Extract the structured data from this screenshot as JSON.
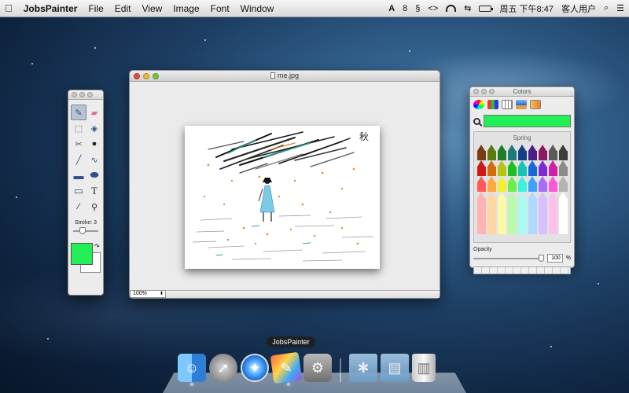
{
  "menubar": {
    "app_name": "JobsPainter",
    "menus": [
      "File",
      "Edit",
      "View",
      "Image",
      "Font",
      "Window"
    ],
    "status": {
      "adobe": "A",
      "notifications": "8",
      "clock": "周五 下午8:47",
      "user": "客人用户"
    }
  },
  "tools": {
    "stroke_label": "Stroke: 3",
    "foreground_color": "#22ee55",
    "background_color": "#ffffff"
  },
  "document": {
    "title": "me.jpg",
    "zoom": "100%",
    "signature": "秋"
  },
  "colors_panel": {
    "title": "Colors",
    "current_color": "#22ee55",
    "box_name": "Spring",
    "opacity_label": "Opacity",
    "opacity_value": "100",
    "opacity_unit": "%",
    "opacity_fraction": 1.0,
    "crayon_rows": [
      [
        "#7b3b12",
        "#5a7a10",
        "#1f7c2b",
        "#1c7a78",
        "#133e8a",
        "#4b1f86",
        "#8a1a5e",
        "#5a5a5a",
        "#3c3c3c"
      ],
      [
        "#d11818",
        "#d46c0f",
        "#b6c414",
        "#1fbf24",
        "#14c4b4",
        "#1769d9",
        "#7d2ad6",
        "#d31ea8",
        "#8a8a8a"
      ],
      [
        "#ff5a5a",
        "#ffa83d",
        "#f3f032",
        "#6bf04a",
        "#3ef0de",
        "#3fa3ff",
        "#a96bff",
        "#ff5ad6",
        "#b3b3b3"
      ],
      [
        "#ffb3b3",
        "#ffd6a1",
        "#fbf9a8",
        "#b8fbaa",
        "#a7fbf3",
        "#b0d7ff",
        "#d8c0ff",
        "#ffc0ee",
        "#ffffff"
      ]
    ]
  },
  "dock": {
    "tooltip": "JobsPainter"
  }
}
